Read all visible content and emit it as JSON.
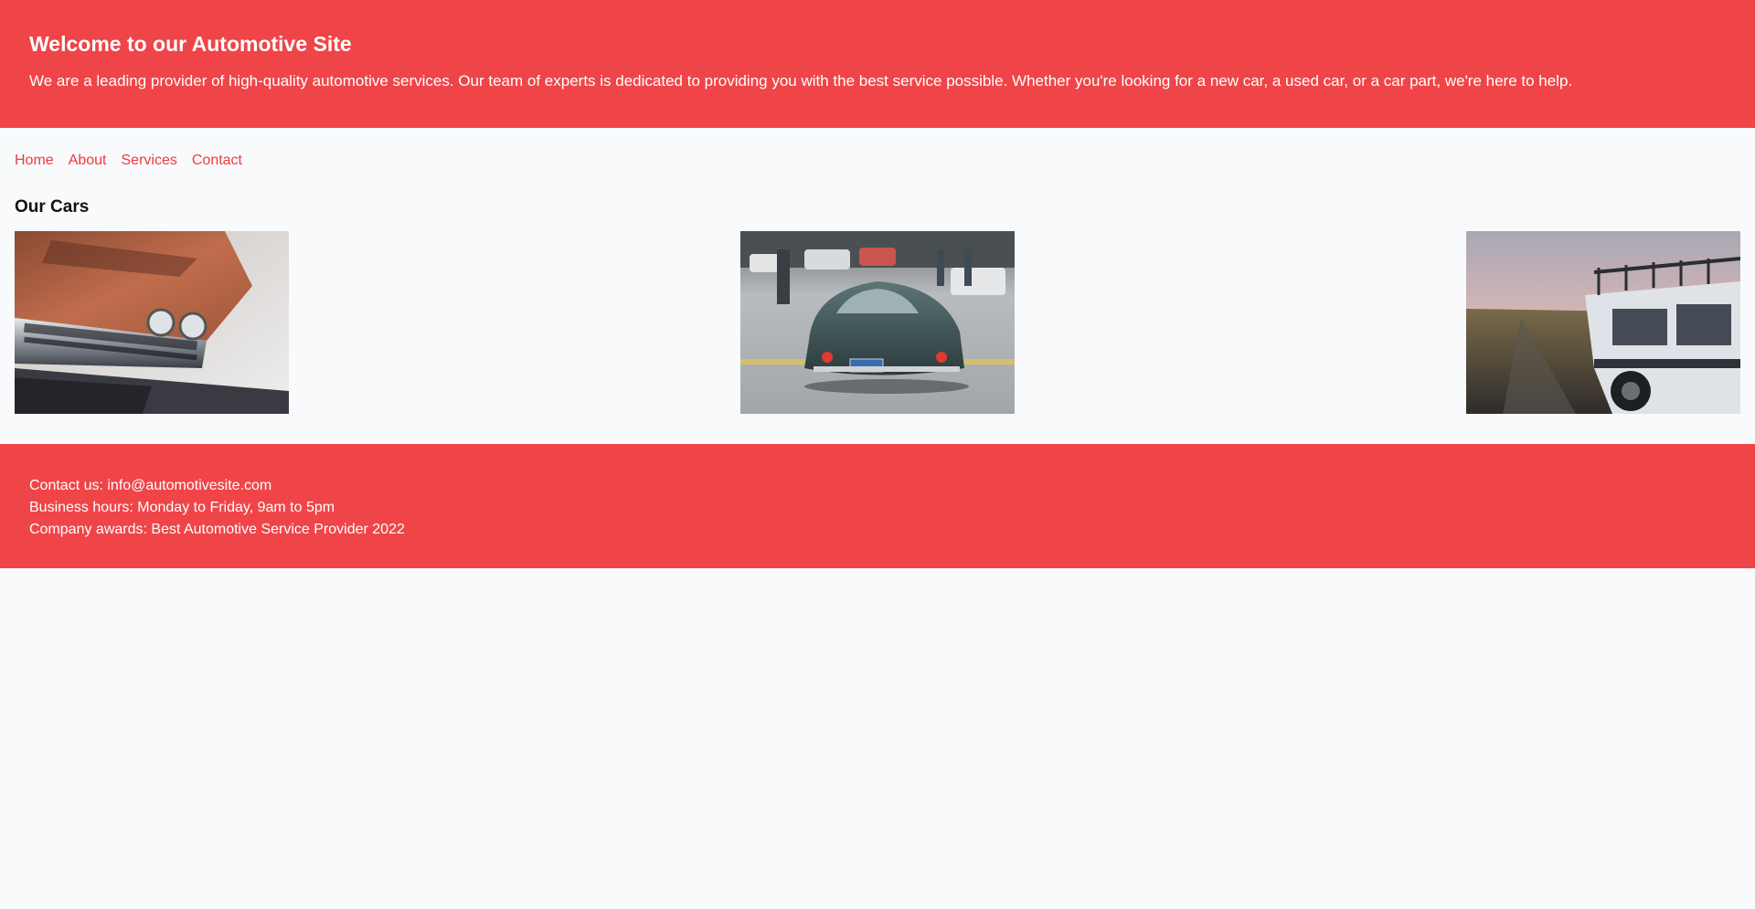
{
  "header": {
    "title": "Welcome to our Automotive Site",
    "description": "We are a leading provider of high-quality automotive services. Our team of experts is dedicated to providing you with the best service possible. Whether you're looking for a new car, a used car, or a car part, we're here to help."
  },
  "nav": {
    "items": [
      "Home",
      "About",
      "Services",
      "Contact"
    ]
  },
  "cars": {
    "title": "Our Cars",
    "images": [
      {
        "icon": "vintage-car-grille-photo"
      },
      {
        "icon": "classic-coupe-rear-photo"
      },
      {
        "icon": "white-offroad-suv-photo"
      }
    ]
  },
  "footer": {
    "contact": "Contact us: info@automotivesite.com",
    "hours": "Business hours: Monday to Friday, 9am to 5pm",
    "awards": "Company awards: Best Automotive Service Provider 2022"
  },
  "colors": {
    "brand": "#ef4548",
    "link": "#ef3b3f",
    "background": "#f8fafc"
  }
}
